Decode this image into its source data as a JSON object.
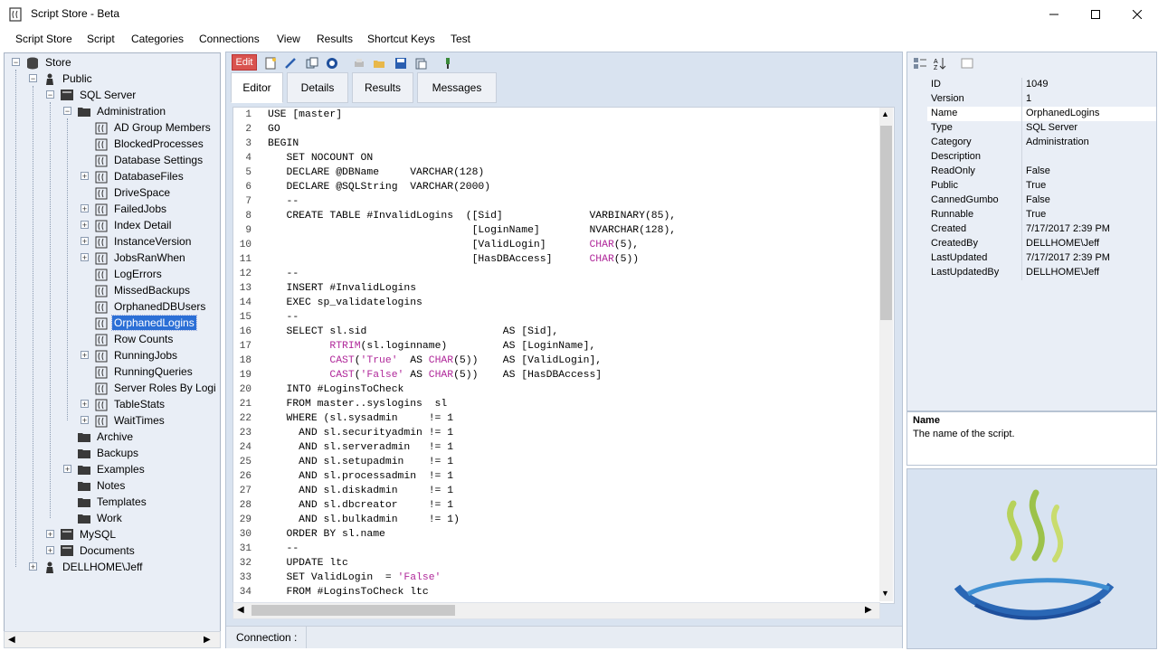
{
  "window": {
    "title": "Script Store - Beta"
  },
  "menu": [
    "Script Store",
    "Script",
    "Categories",
    "Connections",
    "View",
    "Results",
    "Shortcut Keys",
    "Test"
  ],
  "tree": {
    "root": "Store",
    "public": "Public",
    "sql_server": "SQL Server",
    "administration": "Administration",
    "scripts": [
      "AD Group Members",
      "BlockedProcesses",
      "Database Settings",
      "DatabaseFiles",
      "DriveSpace",
      "FailedJobs",
      "Index Detail",
      "InstanceVersion",
      "JobsRanWhen",
      "LogErrors",
      "MissedBackups",
      "OrphanedDBUsers",
      "OrphanedLogins",
      "Row Counts",
      "RunningJobs",
      "RunningQueries",
      "Server Roles By Logi",
      "TableStats",
      "WaitTimes"
    ],
    "selected_script": "OrphanedLogins",
    "categories": [
      "Archive",
      "Backups",
      "Examples",
      "Notes",
      "Templates",
      "Work"
    ],
    "mysql": "MySQL",
    "documents": "Documents",
    "user": "DELLHOME\\Jeff"
  },
  "toolbar": {
    "edit_badge": "Edit"
  },
  "tabs": [
    "Editor",
    "Details",
    "Results",
    "Messages"
  ],
  "editor": {
    "lines": [
      "USE [master]",
      "GO",
      "BEGIN",
      "   SET NOCOUNT ON",
      "   DECLARE @DBName     VARCHAR(128)",
      "   DECLARE @SQLString  VARCHAR(2000)",
      "   --",
      "   CREATE TABLE #InvalidLogins  ([Sid]              VARBINARY(85),",
      "                                 [LoginName]        NVARCHAR(128),",
      "                                 [ValidLogin]       CHAR(5),",
      "                                 [HasDBAccess]      CHAR(5))",
      "   --",
      "   INSERT #InvalidLogins",
      "   EXEC sp_validatelogins",
      "   --",
      "   SELECT sl.sid                      AS [Sid],",
      "          RTRIM(sl.loginname)         AS [LoginName],",
      "          CAST('True'  AS CHAR(5))    AS [ValidLogin],",
      "          CAST('False' AS CHAR(5))    AS [HasDBAccess]",
      "   INTO #LoginsToCheck",
      "   FROM master..syslogins  sl",
      "   WHERE (sl.sysadmin     != 1",
      "     AND sl.securityadmin != 1",
      "     AND sl.serveradmin   != 1",
      "     AND sl.setupadmin    != 1",
      "     AND sl.processadmin  != 1",
      "     AND sl.diskadmin     != 1",
      "     AND sl.dbcreator     != 1",
      "     AND sl.bulkadmin     != 1)",
      "   ORDER BY sl.name",
      "   --",
      "   UPDATE ltc",
      "   SET ValidLogin  = 'False'",
      "   FROM #LoginsToCheck ltc"
    ]
  },
  "status": {
    "connection_label": "Connection :"
  },
  "properties": [
    {
      "key": "ID",
      "value": "1049"
    },
    {
      "key": "Version",
      "value": "1"
    },
    {
      "key": "Name",
      "value": "OrphanedLogins"
    },
    {
      "key": "Type",
      "value": "SQL Server"
    },
    {
      "key": "Category",
      "value": "Administration"
    },
    {
      "key": "Description",
      "value": ""
    },
    {
      "key": "ReadOnly",
      "value": "False"
    },
    {
      "key": "Public",
      "value": "True"
    },
    {
      "key": "CannedGumbo",
      "value": "False"
    },
    {
      "key": "Runnable",
      "value": "True"
    },
    {
      "key": "Created",
      "value": "7/17/2017 2:39 PM"
    },
    {
      "key": "CreatedBy",
      "value": "DELLHOME\\Jeff"
    },
    {
      "key": "LastUpdated",
      "value": "7/17/2017 2:39 PM"
    },
    {
      "key": "LastUpdatedBy",
      "value": "DELLHOME\\Jeff"
    }
  ],
  "property_description": {
    "title": "Name",
    "text": "The name of the script."
  },
  "colors": {
    "selection": "#2b6fd6",
    "edit_badge": "#d9534f",
    "keyword": "#1a1aa6",
    "function": "#b0289a"
  }
}
